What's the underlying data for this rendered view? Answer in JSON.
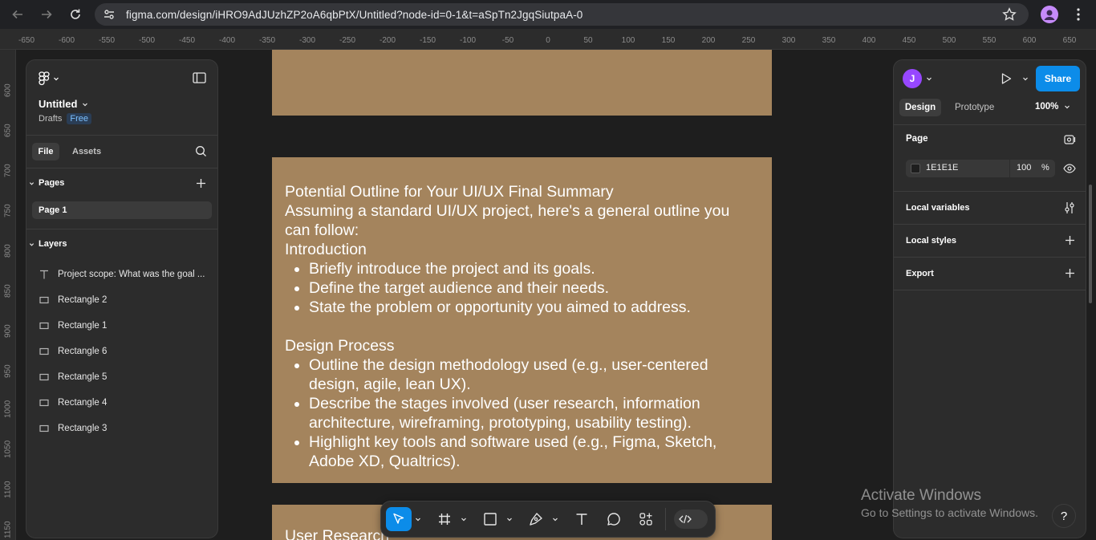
{
  "browser": {
    "url": "figma.com/design/iHRO9AdJUzhZP2oA6qbPtX/Untitled?node-id=0-1&t=aSpTn2JgqSiutpaA-0"
  },
  "rulers": {
    "top": [
      "-650",
      "-600",
      "-550",
      "-500",
      "-450",
      "-400",
      "-350",
      "-300",
      "-250",
      "-200",
      "-150",
      "-100",
      "-50",
      "0",
      "50",
      "100",
      "150",
      "200",
      "250",
      "300",
      "350",
      "400",
      "450",
      "500",
      "550",
      "600",
      "650"
    ],
    "left": [
      "600",
      "650",
      "700",
      "750",
      "800",
      "850",
      "900",
      "950",
      "1000",
      "1050",
      "1100",
      "1150"
    ]
  },
  "left_panel": {
    "file_name": "Untitled",
    "location": "Drafts",
    "plan_badge": "Free",
    "tabs": {
      "file": "File",
      "assets": "Assets"
    },
    "pages_header": "Pages",
    "pages": [
      "Page 1"
    ],
    "layers_header": "Layers",
    "layers": [
      {
        "type": "text",
        "name": "Project scope: What was the goal ..."
      },
      {
        "type": "rect",
        "name": "Rectangle 2"
      },
      {
        "type": "rect",
        "name": "Rectangle 1"
      },
      {
        "type": "rect",
        "name": "Rectangle 6"
      },
      {
        "type": "rect",
        "name": "Rectangle 5"
      },
      {
        "type": "rect",
        "name": "Rectangle 4"
      },
      {
        "type": "rect",
        "name": "Rectangle 3"
      }
    ]
  },
  "canvas": {
    "frame_color": "#A4845D",
    "lines": [
      "Potential Outline for Your UI/UX Final Summary",
      "Assuming a standard UI/UX project, here's a general outline you can follow:",
      "Introduction"
    ],
    "intro_bullets": [
      "Briefly introduce the project and its goals.",
      "Define the target audience and their needs.",
      "State the problem or opportunity you aimed to address."
    ],
    "design_process_heading": "Design Process",
    "design_bullets": [
      "Outline the design methodology used (e.g., user-centered design, agile, lean UX).",
      "Describe the stages involved (user research, information architecture, wireframing, prototyping, usability testing).",
      "Highlight key tools and software used (e.g., Figma, Sketch, Adobe XD, Qualtrics)."
    ],
    "next_frame_heading": "User Research"
  },
  "right_panel": {
    "avatar_initial": "J",
    "share_label": "Share",
    "tabs": {
      "design": "Design",
      "prototype": "Prototype"
    },
    "zoom": "100%",
    "page_section": "Page",
    "page_color_hex": "1E1E1E",
    "page_opacity": "100",
    "percent_sign": "%",
    "local_variables": "Local variables",
    "local_styles": "Local styles",
    "export": "Export"
  },
  "watermark": {
    "title": "Activate Windows",
    "subtitle": "Go to Settings to activate Windows."
  },
  "help_label": "?",
  "colors": {
    "accent": "#0C8CE9",
    "frame": "#A4845D",
    "panel": "#2C2C2C",
    "canvas": "#1E1E1E",
    "avatar": "#9747FF"
  }
}
